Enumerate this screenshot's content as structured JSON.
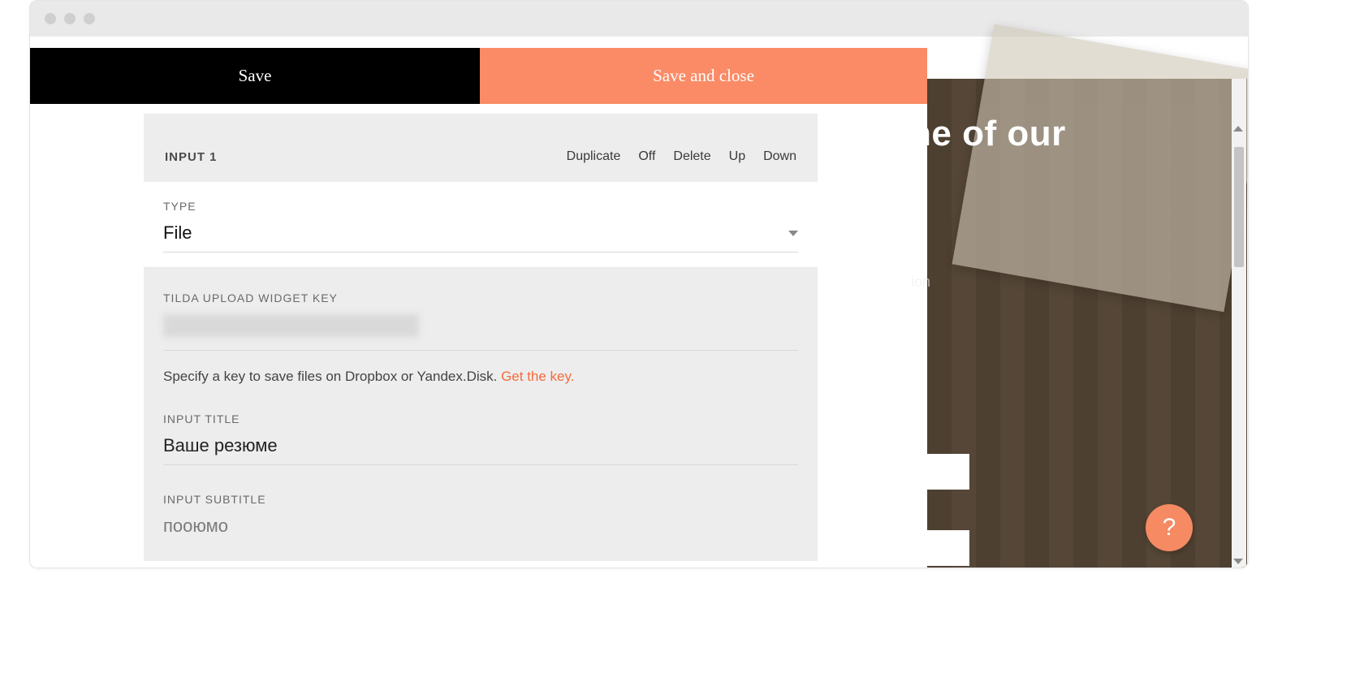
{
  "topbar": {
    "save_label": "Save",
    "save_close_label": "Save and close"
  },
  "panel": {
    "title": "INPUT 1",
    "actions": {
      "duplicate": "Duplicate",
      "off": "Off",
      "delete": "Delete",
      "up": "Up",
      "down": "Down"
    },
    "type": {
      "label": "TYPE",
      "value": "File"
    },
    "widget_key": {
      "label": "TILDA UPLOAD WIDGET KEY",
      "help_prefix": "Specify a key to save files on Dropbox or Yandex.Disk. ",
      "help_link": "Get the key."
    },
    "input_title": {
      "label": "INPUT TITLE",
      "value": "Ваше резюме"
    },
    "input_subtitle": {
      "label": "INPUT SUBTITLE",
      "value_partial": "пооюмо"
    }
  },
  "preview": {
    "headline": "ne of our",
    "sub_fragment": "ion"
  },
  "help_fab": "?"
}
